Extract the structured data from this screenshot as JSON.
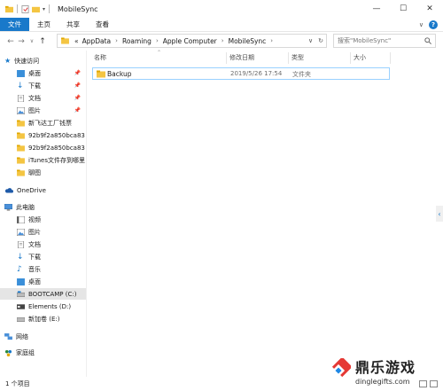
{
  "window": {
    "title": "MobileSync"
  },
  "ribbon": {
    "tabs": [
      "文件",
      "主页",
      "共享",
      "查看"
    ]
  },
  "address": {
    "crumbs": [
      "«",
      "AppData",
      "Roaming",
      "Apple Computer",
      "MobileSync"
    ]
  },
  "search": {
    "placeholder": "搜索\"MobileSync\""
  },
  "sidebar": {
    "quick_access": "快速访问",
    "pinned": [
      "桌面",
      "下载",
      "文档",
      "图片"
    ],
    "recent": [
      "新飞达工厂钱票",
      "92b9f2a850bca83",
      "92b9f2a850bca83",
      "iTunes文件存到哪里",
      "聊图"
    ],
    "onedrive": "OneDrive",
    "this_pc": "此电脑",
    "pc_items": [
      "视频",
      "图片",
      "文档",
      "下载",
      "音乐",
      "桌面"
    ],
    "drives": [
      "BOOTCAMP (C:)",
      "Elements (D:)",
      "新加卷 (E:)"
    ],
    "network": "网络",
    "homegroup": "家庭组"
  },
  "columns": {
    "name": "名称",
    "modified": "修改日期",
    "type": "类型",
    "size": "大小"
  },
  "files": [
    {
      "name": "Backup",
      "modified": "2019/5/26 17:54",
      "type": "文件夹",
      "size": ""
    }
  ],
  "status": {
    "count": "1 个项目"
  },
  "watermark": {
    "cn": "鼎乐游戏",
    "en": "dinglegifts.com"
  },
  "colors": {
    "accent": "#1979ca",
    "folder": "#f4c542",
    "selection": "#99d1ff"
  }
}
